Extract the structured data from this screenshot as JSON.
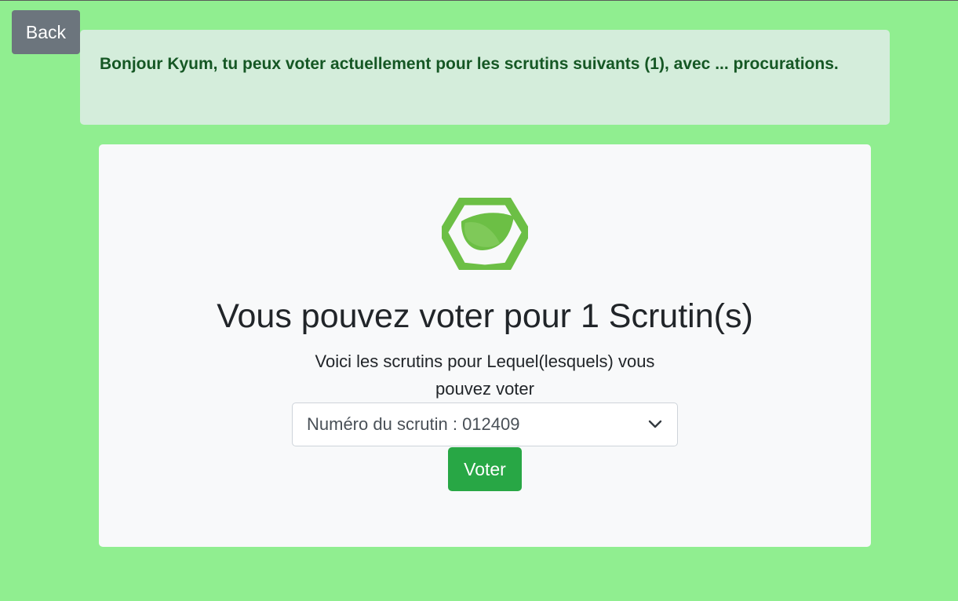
{
  "back_button": {
    "label": "Back"
  },
  "alert": {
    "message": "Bonjour Kyum, tu peux voter actuellement pour les scrutins suivants (1), avec ... procurations."
  },
  "card": {
    "logo_icon": "leaf-hexagon-icon",
    "title": "Vous pouvez voter pour 1 Scrutin(s)",
    "subtitle": "Voici les scrutins pour Lequel(lesquels) vous pouvez voter",
    "select": {
      "selected": "Numéro du scrutin : 012409",
      "chevron_icon": "chevron-down-icon"
    },
    "vote_button": {
      "label": "Voter"
    }
  },
  "colors": {
    "background": "#90ee90",
    "alert_bg": "#d4eddb",
    "alert_text": "#155724",
    "back_button": "#6c757d",
    "vote_button": "#28a745",
    "logo_green": "#6cbf45"
  }
}
